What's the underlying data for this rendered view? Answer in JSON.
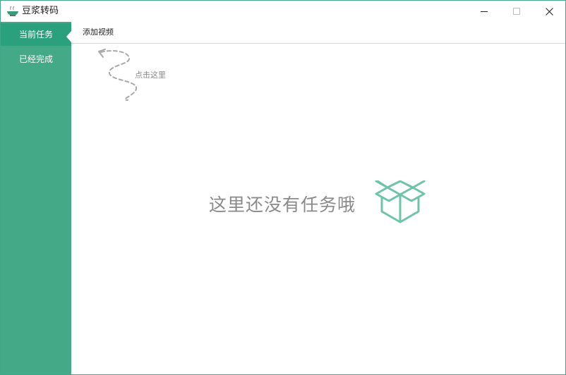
{
  "window": {
    "title": "豆浆转码",
    "icon": "soy-milk-bowl-icon",
    "controls": [
      "minimize-icon",
      "maximize-icon",
      "close-icon"
    ]
  },
  "sidebar": {
    "items": [
      {
        "label": "当前任务",
        "active": true
      },
      {
        "label": "已经完成",
        "active": false
      }
    ]
  },
  "toolbar": {
    "add_video_label": "添加视频"
  },
  "main": {
    "hint_text": "点击这里",
    "empty_text": "这里还没有任务哦",
    "empty_icon": "open-box-icon"
  },
  "colors": {
    "accent": "#43a987",
    "accent_active": "#2aa07c",
    "box_icon": "#6ec4a7"
  }
}
